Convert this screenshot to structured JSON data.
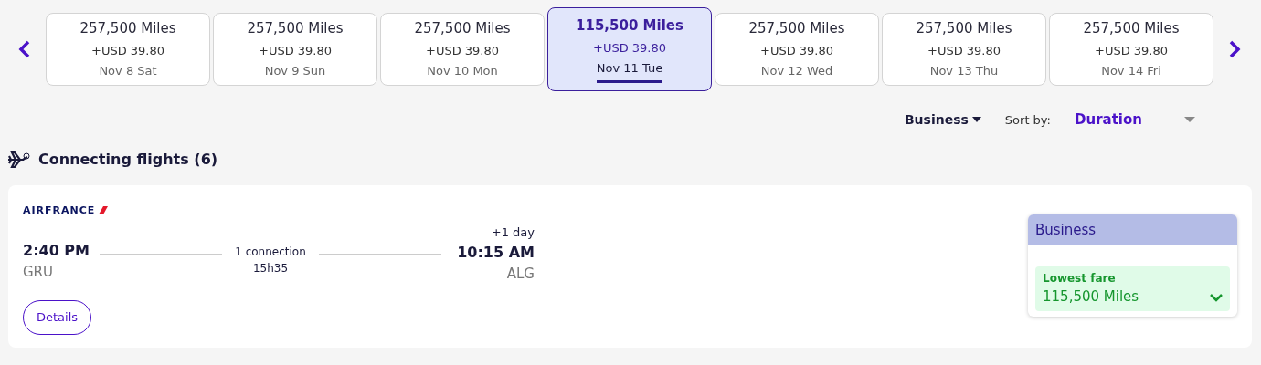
{
  "dates": [
    {
      "miles": "257,500 Miles",
      "fee": "+USD 39.80",
      "date": "Nov 8 Sat",
      "selected": false
    },
    {
      "miles": "257,500 Miles",
      "fee": "+USD 39.80",
      "date": "Nov 9 Sun",
      "selected": false
    },
    {
      "miles": "257,500 Miles",
      "fee": "+USD 39.80",
      "date": "Nov 10 Mon",
      "selected": false
    },
    {
      "miles": "115,500 Miles",
      "fee": "+USD 39.80",
      "date": "Nov 11 Tue",
      "selected": true
    },
    {
      "miles": "257,500 Miles",
      "fee": "+USD 39.80",
      "date": "Nov 12 Wed",
      "selected": false
    },
    {
      "miles": "257,500 Miles",
      "fee": "+USD 39.80",
      "date": "Nov 13 Thu",
      "selected": false
    },
    {
      "miles": "257,500 Miles",
      "fee": "+USD 39.80",
      "date": "Nov 14 Fri",
      "selected": false
    }
  ],
  "cabin": "Business",
  "sort_label": "Sort by:",
  "sort_value": "Duration",
  "section_title": "Connecting flights (6)",
  "flight": {
    "airline": "AIRFRANCE",
    "depart_time": "2:40 PM",
    "depart_airport": "GRU",
    "connection": "1 connection",
    "duration": "15h35",
    "day_offset": "+1 day",
    "arrive_time": "10:15 AM",
    "arrive_airport": "ALG",
    "details": "Details",
    "fare": {
      "cabin": "Business",
      "label": "Lowest fare",
      "miles": "115,500 Miles"
    }
  }
}
